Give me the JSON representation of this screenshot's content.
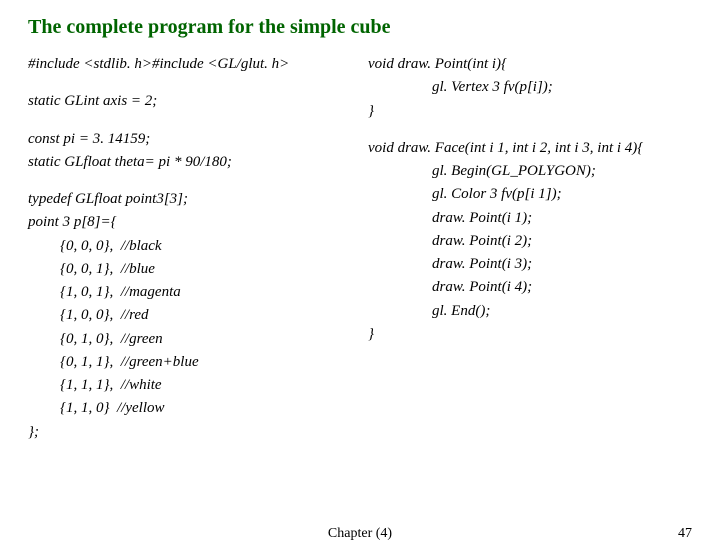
{
  "title": "The complete program for the simple cube",
  "left": {
    "include": "#include <stdlib. h>#include <GL/glut. h>",
    "axis": "static GLint axis = 2;",
    "pi": "const pi = 3. 14159;",
    "theta": "static GLfloat theta= pi * 90/180;",
    "typedef": "typedef GLfloat point3[3];",
    "decl": "point 3 p[8]={",
    "l0": "{0, 0, 0},  //black",
    "l1": "{0, 0, 1},  //blue",
    "l2": "{1, 0, 1},  //magenta",
    "l3": "{1, 0, 0},  //red",
    "l4": "{0, 1, 0},  //green",
    "l5": "{0, 1, 1},  //green+blue",
    "l6": "{1, 1, 1},  //white",
    "l7": "{1, 1, 0}  //yellow",
    "close": "};"
  },
  "right": {
    "fn1": "void draw. Point(int i){",
    "fn1body": "gl. Vertex 3 fv(p[i]);",
    "fn1close": "}",
    "fn2": "void draw. Face(int i 1, int i 2, int i 3, int i 4){",
    "b0": "gl. Begin(GL_POLYGON);",
    "b1": "gl. Color 3 fv(p[i 1]);",
    "b2": "draw. Point(i 1);",
    "b3": "draw. Point(i 2);",
    "b4": "draw. Point(i 3);",
    "b5": "draw. Point(i 4);",
    "b6": "gl. End();",
    "fn2close": "}"
  },
  "footer": {
    "center": "Chapter (4)",
    "page": "47"
  }
}
